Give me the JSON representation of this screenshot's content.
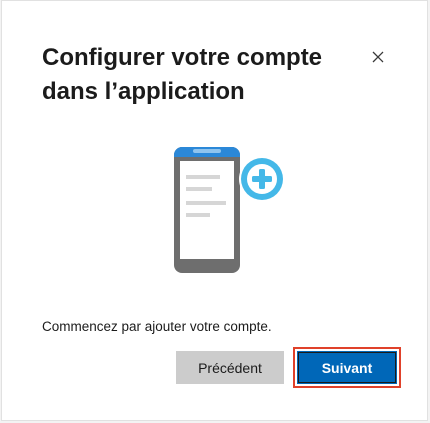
{
  "dialog": {
    "title": "Configurer votre compte dans l’application",
    "message": "Commencez par ajouter votre compte.",
    "back_label": "Précédent",
    "next_label": "Suivant",
    "close_icon": "close-icon",
    "illustration_icons": [
      "phone-icon",
      "add-circle-icon"
    ]
  },
  "colors": {
    "primary": "#0067b8",
    "secondary_button": "#cccccc",
    "highlight": "#e0412a",
    "phone_accent": "#2b88d8",
    "add_circle": "#44b8e8"
  }
}
